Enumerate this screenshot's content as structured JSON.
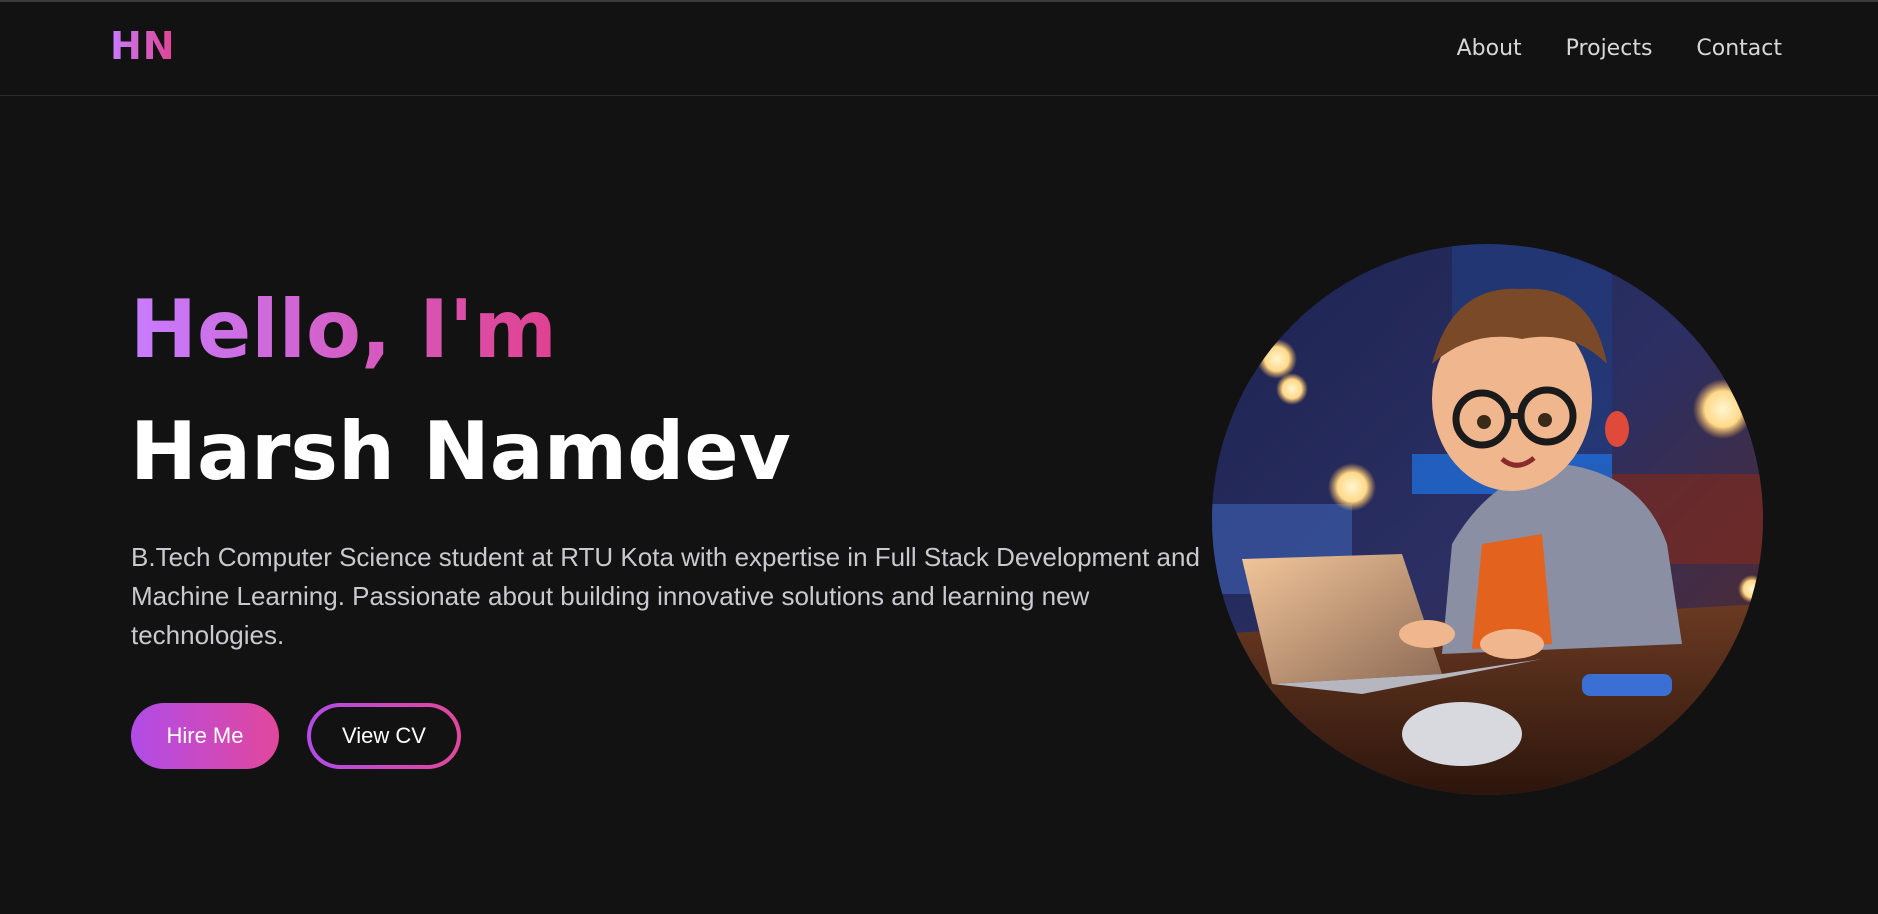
{
  "nav": {
    "logo": "HN",
    "links": [
      "About",
      "Projects",
      "Contact"
    ]
  },
  "hero": {
    "greeting": "Hello, I'm",
    "name": "Harsh Namdev",
    "description": "B.Tech Computer Science student at RTU Kota with expertise in Full Stack Development and Machine Learning. Passionate about building innovative solutions and learning new technologies.",
    "buttons": {
      "hire": "Hire Me",
      "cv": "View CV"
    }
  },
  "colors": {
    "background": "#121212",
    "gradient_start": "#c77dff",
    "gradient_end": "#e0418f",
    "text_primary": "#ffffff",
    "text_secondary": "#c9c9cf"
  }
}
